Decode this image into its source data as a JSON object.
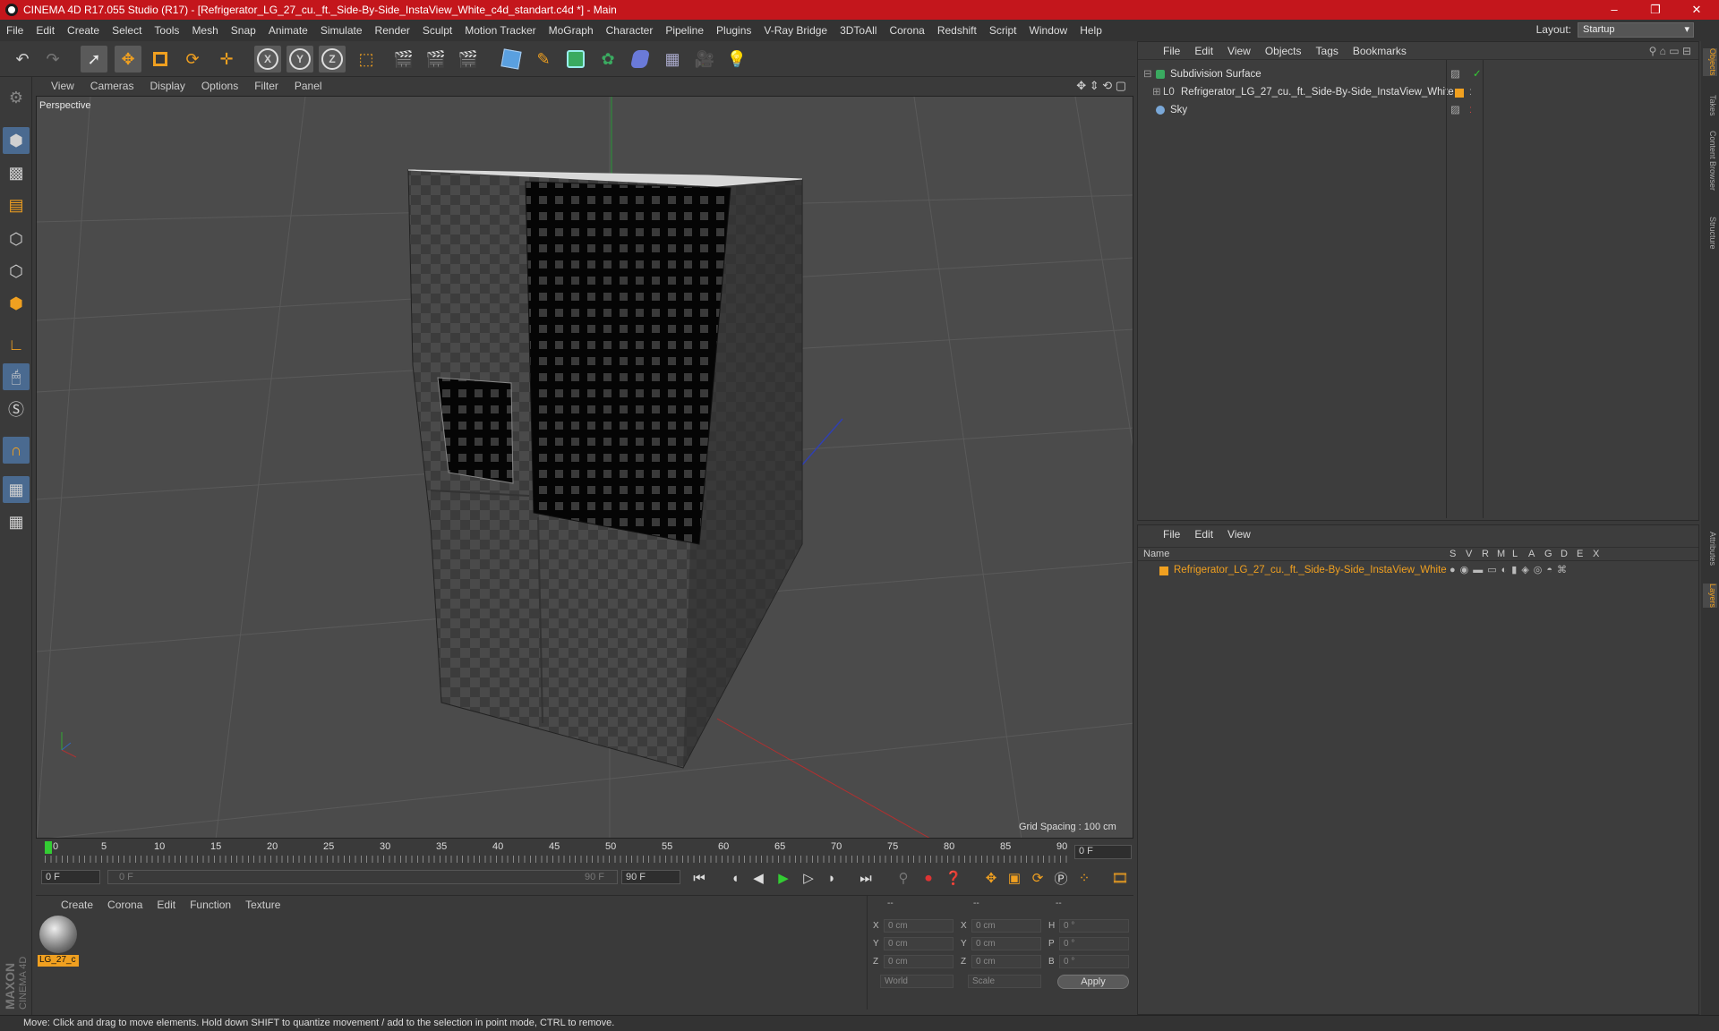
{
  "window": {
    "title": "CINEMA 4D R17.055 Studio (R17) - [Refrigerator_LG_27_cu._ft._Side-By-Side_InstaView_White_c4d_standart.c4d *] - Main",
    "controls": [
      "–",
      "❐",
      "✕"
    ]
  },
  "menubar": {
    "items": [
      "File",
      "Edit",
      "Create",
      "Select",
      "Tools",
      "Mesh",
      "Snap",
      "Animate",
      "Simulate",
      "Render",
      "Sculpt",
      "Motion Tracker",
      "MoGraph",
      "Character",
      "Pipeline",
      "Plugins",
      "V-Ray Bridge",
      "3DToAll",
      "Corona",
      "Redshift",
      "Script",
      "Window",
      "Help"
    ],
    "layout_label": "Layout:",
    "layout_value": "Startup"
  },
  "viewport": {
    "menu": [
      "View",
      "Cameras",
      "Display",
      "Options",
      "Filter",
      "Panel"
    ],
    "camera_label": "Perspective",
    "grid_spacing": "Grid Spacing : 100 cm"
  },
  "timeline": {
    "ticks": [
      "0",
      "5",
      "10",
      "15",
      "20",
      "25",
      "30",
      "35",
      "40",
      "45",
      "50",
      "55",
      "60",
      "65",
      "70",
      "75",
      "80",
      "85",
      "90"
    ],
    "current_frame": "0 F",
    "start_field": "0 F",
    "range_start": "0 F",
    "range_end": "90 F",
    "end_field": "90 F"
  },
  "material_manager": {
    "menu": [
      "Create",
      "Corona",
      "Edit",
      "Function",
      "Texture"
    ],
    "material_name": "LG_27_c"
  },
  "coordinates": {
    "header": [
      "--",
      "--",
      "--"
    ],
    "rows": [
      {
        "a": "X",
        "v1": "0 cm",
        "b": "X",
        "v2": "0 cm",
        "c": "H",
        "v3": "0 °"
      },
      {
        "a": "Y",
        "v1": "0 cm",
        "b": "Y",
        "v2": "0 cm",
        "c": "P",
        "v3": "0 °"
      },
      {
        "a": "Z",
        "v1": "0 cm",
        "b": "Z",
        "v2": "0 cm",
        "c": "B",
        "v3": "0 °"
      }
    ],
    "mode1": "World",
    "mode2": "Scale",
    "apply": "Apply"
  },
  "object_manager": {
    "menu": [
      "File",
      "Edit",
      "View",
      "Objects",
      "Tags",
      "Bookmarks"
    ],
    "objects": [
      {
        "name": "Subdivision Surface"
      },
      {
        "name": "Refrigerator_LG_27_cu._ft._Side-By-Side_InstaView_White"
      },
      {
        "name": "Sky"
      }
    ]
  },
  "layer_manager": {
    "menu": [
      "File",
      "Edit",
      "View"
    ],
    "name_header": "Name",
    "col_headers": [
      "S",
      "V",
      "R",
      "M",
      "L",
      "A",
      "G",
      "D",
      "E",
      "X"
    ],
    "layer_name": "Refrigerator_LG_27_cu._ft._Side-By-Side_InstaView_White"
  },
  "right_tabs": [
    "Objects",
    "Takes",
    "Content Browser",
    "Structure",
    "Attributes",
    "Layers"
  ],
  "logo": {
    "line1": "MAXON",
    "line2": "CINEMA 4D"
  },
  "status": "Move: Click and drag to move elements. Hold down SHIFT to quantize movement / add to the selection in point mode, CTRL to remove.",
  "colors": {
    "title_bar": "#c4161c",
    "accent_orange": "#f0a020",
    "selection_blue": "#4a6a90"
  }
}
